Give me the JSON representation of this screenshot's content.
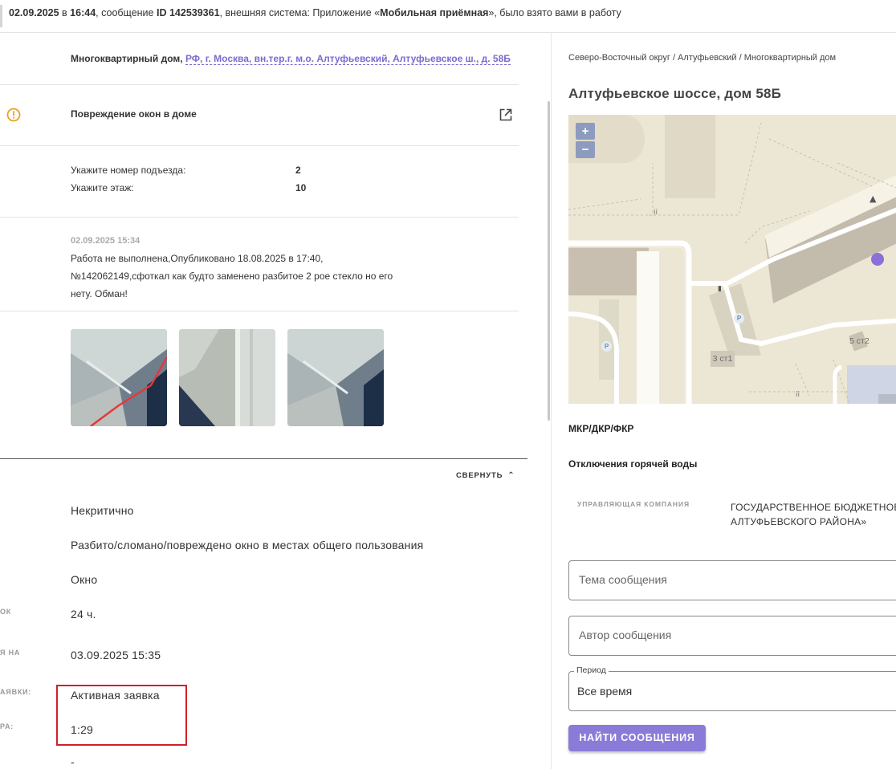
{
  "topbar": {
    "date": "02.09.2025",
    "in_word": "в",
    "time": "16:44",
    "message_word": ", сообщение",
    "message_id": "ID 142539361",
    "system_text": ", внешняя система: Приложение «",
    "system_name": "Мобильная приёмная",
    "taken_text": "», было взято вами в работу"
  },
  "request": {
    "object_type": "Многоквартирный дом,",
    "address": "РФ, г. Москва, вн.тер.г. м.о. Алтуфьевский, Алтуфьевское ш., д. 58Б",
    "problem": "Повреждение окон в доме",
    "fields": [
      {
        "label": "Укажите номер подъезда:",
        "value": "2"
      },
      {
        "label": "Укажите этаж:",
        "value": "10"
      }
    ],
    "comment": {
      "date": "02.09.2025 15:34",
      "text": "Работа не выполнена,Опубликовано 18.08.2025 в 17:40, №142062149,сфоткал как будто заменено разбитое 2 рое стекло но его нету. Обман!"
    },
    "collapse_label": "СВЕРНУТЬ",
    "details": [
      {
        "label": "",
        "value": "Некритично"
      },
      {
        "label": "",
        "value": "Разбито/сломано/повреждено окно в местах общего пользования"
      },
      {
        "label": "",
        "value": "Окно"
      },
      {
        "label": "ОК",
        "value": "24 ч."
      },
      {
        "label": "Я НА",
        "value": "03.09.2025 15:35"
      },
      {
        "label": "АЯВКИ:",
        "value": "Активная заявка"
      },
      {
        "label": "РА:",
        "value": "1:29"
      },
      {
        "label": "",
        "value": "-"
      }
    ]
  },
  "location": {
    "breadcrumb": "Северо-Восточный округ / Алтуфьевский / Многоквартирный дом",
    "title": "Алтуфьевское шоссе, дом 58Б",
    "map": {
      "zoom_in": "+",
      "zoom_out": "−",
      "labels": [
        "3 ст1",
        "5 ст2"
      ],
      "parking_glyph": "P"
    },
    "house_type": "МКР/ДКР/ФКР",
    "hot_water": "Отключения горячей воды",
    "management_label": "УПРАВЛЯЮЩАЯ КОМПАНИЯ",
    "management_line1": "ГОСУДАРСТВЕННОЕ БЮДЖЕТНОЕ У",
    "management_line2": "АЛТУФЬЕВСКОГО РАЙОНА»"
  },
  "search": {
    "topic_placeholder": "Тема сообщения",
    "author_placeholder": "Автор сообщения",
    "period_label": "Период",
    "period_value": "Все время",
    "find_button": "НАЙТИ СООБЩЕНИЯ"
  },
  "colors": {
    "accent": "#7b6ad0",
    "button": "#8b7bd8",
    "warning": "#f0a020",
    "highlight": "#d01f2a",
    "map_marker": "#8b6fd6"
  }
}
